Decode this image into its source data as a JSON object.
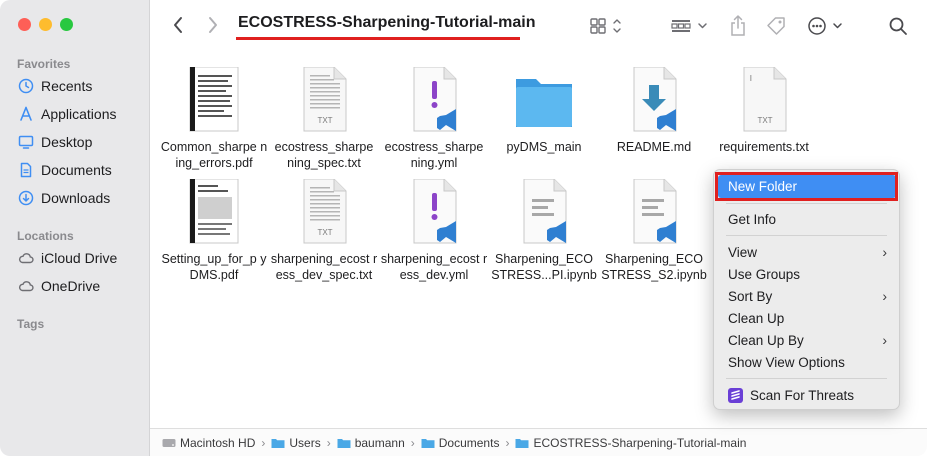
{
  "window": {
    "title": "ECOSTRESS-Sharpening-Tutorial-main"
  },
  "sidebar": {
    "favorites_label": "Favorites",
    "favorites": [
      {
        "label": "Recents",
        "icon": "clock-icon"
      },
      {
        "label": "Applications",
        "icon": "applications-icon"
      },
      {
        "label": "Desktop",
        "icon": "desktop-icon"
      },
      {
        "label": "Documents",
        "icon": "document-icon"
      },
      {
        "label": "Downloads",
        "icon": "download-icon"
      }
    ],
    "locations_label": "Locations",
    "locations": [
      {
        "label": "iCloud Drive",
        "icon": "cloud-icon"
      },
      {
        "label": "OneDrive",
        "icon": "cloud-icon"
      }
    ],
    "tags_label": "Tags"
  },
  "files": [
    {
      "name": "Common_sharpening_errors.pdf",
      "display": "Common_sharpe ning_errors.pdf",
      "kind": "pdf"
    },
    {
      "name": "ecostress_sharpening_spec.txt",
      "display": "ecostress_sharpe ning_spec.txt",
      "kind": "txt"
    },
    {
      "name": "ecostress_sharpening.yml",
      "display": "ecostress_sharpe ning.yml",
      "kind": "yml"
    },
    {
      "name": "pyDMS_main",
      "display": "pyDMS_main",
      "kind": "folder"
    },
    {
      "name": "README.md",
      "display": "README.md",
      "kind": "md"
    },
    {
      "name": "requirements.txt",
      "display": "requirements.txt",
      "kind": "txt-blank"
    },
    {
      "name": "Setting_up_for_pyDMS.pdf",
      "display": "Setting_up_for_p yDMS.pdf",
      "kind": "pdf"
    },
    {
      "name": "sharpening_ecostress_dev_spec.txt",
      "display": "sharpening_ecost ress_dev_spec.txt",
      "kind": "txt"
    },
    {
      "name": "sharpening_ecostress_dev.yml",
      "display": "sharpening_ecost ress_dev.yml",
      "kind": "yml"
    },
    {
      "name": "Sharpening_ECOSTRESS...PI.ipynb",
      "display": "Sharpening_ECO STRESS...PI.ipynb",
      "kind": "ipynb"
    },
    {
      "name": "Sharpening_ECOSTRESS_S2.ipynb",
      "display": "Sharpening_ECO STRESS_S2.ipynb",
      "kind": "ipynb"
    }
  ],
  "context_menu": {
    "new_folder": "New Folder",
    "get_info": "Get Info",
    "view": "View",
    "use_groups": "Use Groups",
    "sort_by": "Sort By",
    "clean_up": "Clean Up",
    "clean_up_by": "Clean Up By",
    "show_view_options": "Show View Options",
    "scan_for_threats": "Scan For Threats"
  },
  "pathbar": [
    "Macintosh HD",
    "Users",
    "baumann",
    "Documents",
    "ECOSTRESS-Sharpening-Tutorial-main"
  ],
  "colors": {
    "accent": "#3f8ef3",
    "annotation_red": "#e0201f",
    "folder_blue": "#4aa8e6",
    "vscode_blue": "#2f7fd1",
    "yml_purple": "#8c44c8"
  }
}
